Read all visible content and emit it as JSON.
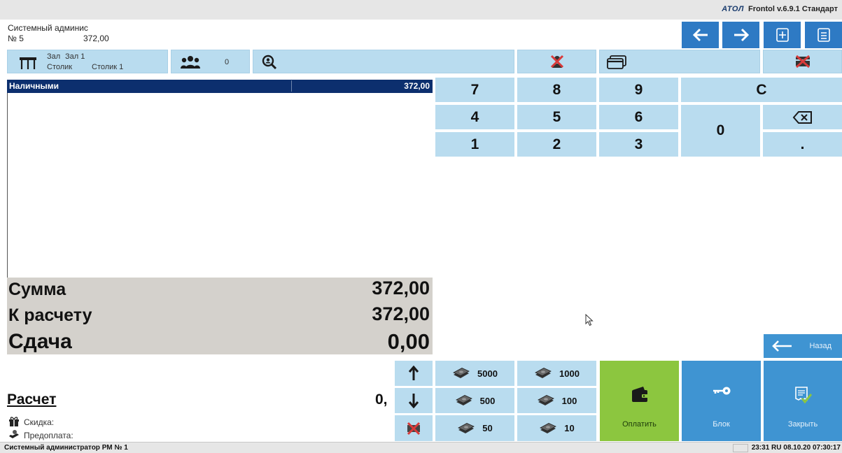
{
  "brand": {
    "logo": "ATOЛ",
    "title": "Frontol v.6.9.1 Стандарт"
  },
  "header": {
    "user": "Системный админис",
    "receipt_no": "№ 5",
    "receipt_total": "372,00"
  },
  "table_info": {
    "hall_label": "Зал",
    "hall_value": "Зал 1",
    "table_label": "Столик",
    "table_value": "Столик 1",
    "guests": "0"
  },
  "payments": [
    {
      "name": "Наличными",
      "amount": "372,00"
    }
  ],
  "totals": {
    "sum_label": "Сумма",
    "sum_value": "372,00",
    "due_label": "К расчету",
    "due_value": "372,00",
    "change_label": "Сдача",
    "change_value": "0,00"
  },
  "keypad": {
    "k7": "7",
    "k8": "8",
    "k9": "9",
    "kC": "C",
    "k4": "4",
    "k5": "5",
    "k6": "6",
    "k0": "0",
    "k1": "1",
    "k2": "2",
    "k3": "3",
    "kdot": "."
  },
  "calc": {
    "label": "Расчет",
    "value": "0,"
  },
  "discount_label": "Скидка:",
  "prepay_label": "Предоплата:",
  "money": {
    "m5000": "5000",
    "m1000": "1000",
    "m500": "500",
    "m100": "100",
    "m50": "50",
    "m10": "10"
  },
  "actions": {
    "pay": "Оплатить",
    "block": "Блок",
    "close": "Закрыть",
    "back": "Назад"
  },
  "status": {
    "user": "Системный администратор  РМ № 1",
    "right": "23:31  RU  08.10.20  07:30:17"
  },
  "colors": {
    "accent_blue": "#2e7ac4",
    "tile_light_blue": "#b9dcef",
    "pay_green": "#8cc63f",
    "selection_navy": "#0c2f6e"
  }
}
